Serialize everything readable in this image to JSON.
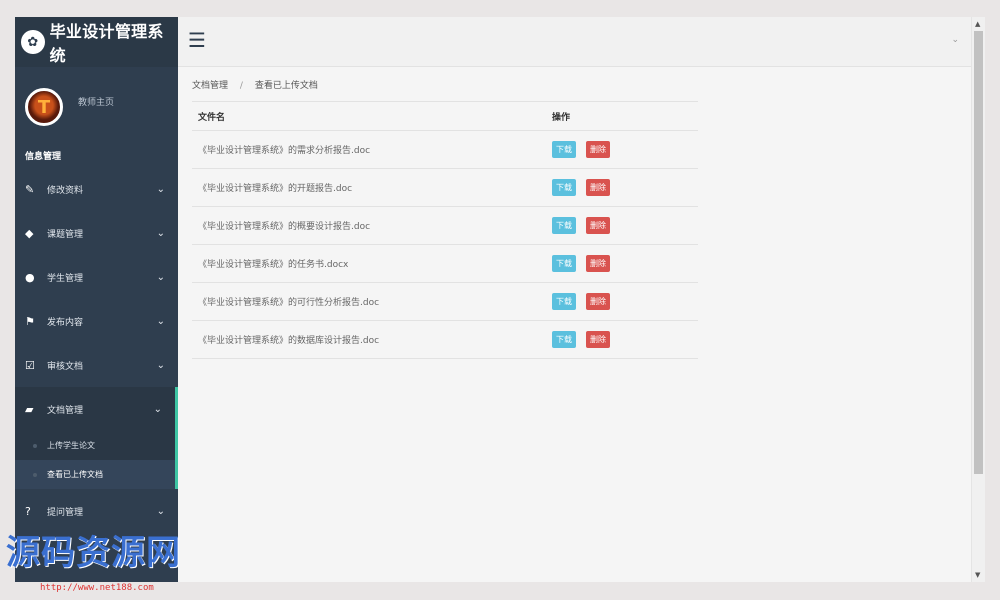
{
  "sidebar": {
    "brand": {
      "icon": "paw-icon",
      "title": "毕业设计管理系统"
    },
    "profile": {
      "name": "教师主页"
    },
    "section_title": "信息管理",
    "items": [
      {
        "label": "修改资料",
        "icon": "edit-icon"
      },
      {
        "label": "课题管理",
        "icon": "tag-icon"
      },
      {
        "label": "学生管理",
        "icon": "user-icon"
      },
      {
        "label": "发布内容",
        "icon": "flag-icon"
      },
      {
        "label": "审核文档",
        "icon": "check-square-icon"
      },
      {
        "label": "文档管理",
        "icon": "folder-open-icon",
        "active": true
      },
      {
        "label": "提问管理",
        "icon": "question-circle-icon"
      }
    ],
    "submenu": [
      {
        "label": "上传学生论文"
      },
      {
        "label": "查看已上传文档",
        "current": true
      }
    ]
  },
  "header": {
    "menu_icon": "hamburger-icon"
  },
  "breadcrumb": {
    "parent": "文档管理",
    "separator": "/",
    "current": "查看已上传文档"
  },
  "table": {
    "headers": {
      "name": "文件名",
      "actions": "操作"
    },
    "download_label": "下载",
    "delete_label": "删除",
    "rows": [
      "《毕业设计管理系统》的需求分析报告.doc",
      "《毕业设计管理系统》的开题报告.doc",
      "《毕业设计管理系统》的概要设计报告.doc",
      "《毕业设计管理系统》的任务书.docx",
      "《毕业设计管理系统》的可行性分析报告.doc",
      "《毕业设计管理系统》的数据库设计报告.doc"
    ]
  },
  "watermark": {
    "text": "源码资源网",
    "url": "http://www.net188.com"
  },
  "colors": {
    "sidebar_bg": "#2f3e4f",
    "accent": "#3ec5a4",
    "download": "#5bc0de",
    "delete": "#d9534f"
  }
}
